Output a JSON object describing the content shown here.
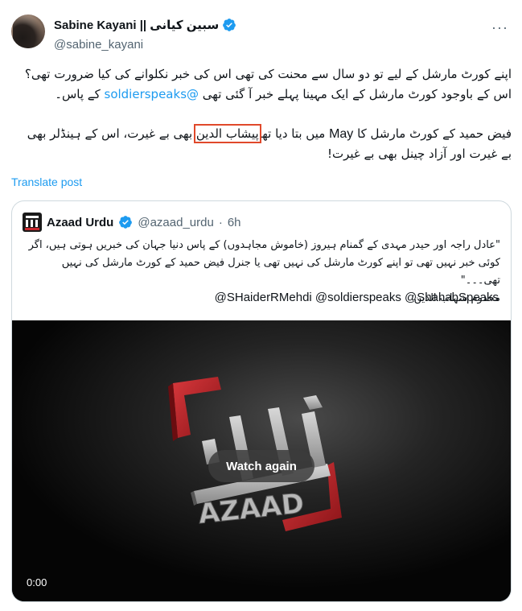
{
  "post": {
    "author_name": "Sabine Kayani || سبین کیانی",
    "author_handle": "@sabine_kayani",
    "more_icon": "more-icon",
    "text": {
      "p1_line1": "اپنے کورٹ مارشل کے لیے تو دو سال سے محنت کی تھی اس کی خبر نکلوانے کی کیا ضرورت تھی؟",
      "p1_line2_before": "اس کے باوجود کورٹ مارشل کے ایک مہینا پہلے خبر آ گئی تھی ",
      "p1_line2_mention": "@soldierspeaks",
      "p1_line2_after": " کے پاس۔",
      "p2_line1_a": "فیض حمید کے کورٹ مارشل کا ",
      "p2_line1_may": "May",
      "p2_line1_b": " میں بتا دیا تھا",
      "p2_line1_highlight": "پیشاب الدین",
      "p2_line1_c": " بھی بے غیرت، اس کے ہینڈلر بھی",
      "p2_line2": "بے غیرت اور آزاد چینل بھی بے غیرت!"
    },
    "translate_label": "Translate post"
  },
  "quote": {
    "name": "Azaad Urdu",
    "handle": "@azaad_urdu",
    "separator": "·",
    "time": "6h",
    "text_line1": "\"عادل راجہ اور حیدر مہدی کے گمنام ہیروز (خاموش مجاہدوں) کے پاس دنیا جہان کی خبریں ہوتی ہیں، اگر",
    "text_line2": "کوئی خبر نہیں تھی تو اپنے کورٹ مارشل کی نہیں تھی یا جنرل فیض حمید کے کورٹ مارشل کی نہیں تھی۔۔۔\"",
    "text_line3": "مخدوم شہاب الدین",
    "mentions": "@SHaiderRMehdi @soldierspeaks @ShahabSpeaks",
    "video": {
      "watch_again": "Watch again",
      "timecode": "0:00",
      "logo_text": "AZAAD"
    }
  },
  "colors": {
    "accent": "#1d9bf0",
    "highlight_box": "#e0492b",
    "logo_red": "#c8262c"
  }
}
